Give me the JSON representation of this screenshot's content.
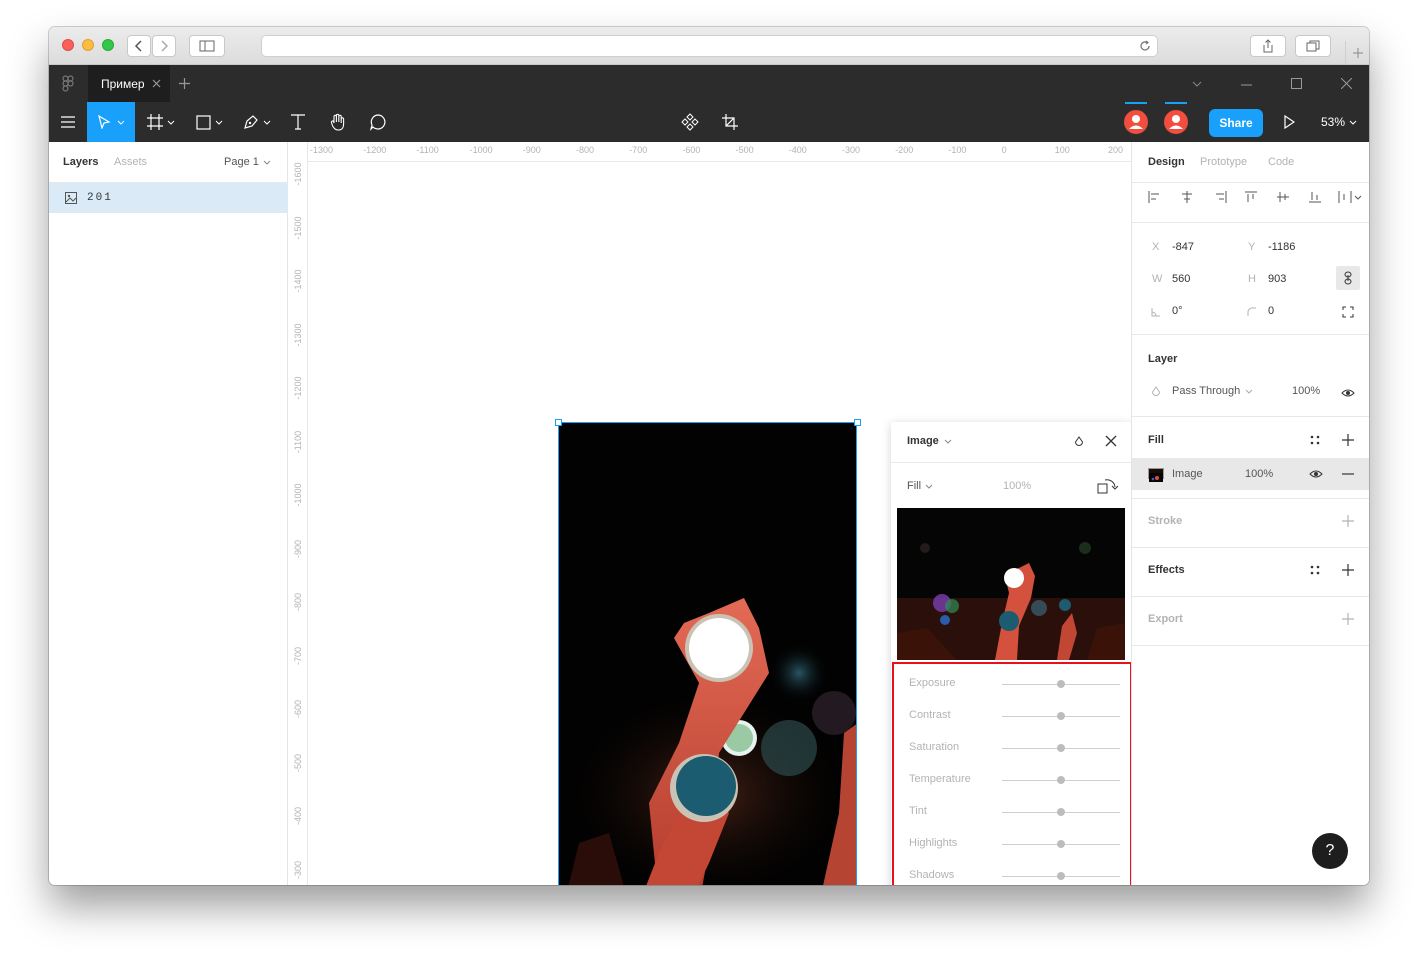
{
  "browser": {
    "traffic_lights": [
      "#fc605b",
      "#fdbc40",
      "#34c84a"
    ]
  },
  "figma": {
    "tab": {
      "title": "Пример"
    },
    "toolbar": {
      "share_label": "Share",
      "zoom": "53%"
    },
    "left_panel": {
      "tabs": [
        "Layers",
        "Assets"
      ],
      "page": "Page 1",
      "layers": [
        {
          "name": "201"
        }
      ]
    },
    "rulers": {
      "horizontal": [
        "-1300",
        "-1200",
        "-1100",
        "-1000",
        "-900",
        "-800",
        "-700",
        "-600",
        "-500",
        "-400",
        "-300",
        "-200",
        "-100",
        "0",
        "100",
        "200"
      ],
      "vertical": [
        "-1600",
        "-1500",
        "-1400",
        "-1300",
        "-1200",
        "-1100",
        "-1000",
        "-900",
        "-800",
        "-700",
        "-600",
        "-500",
        "-400",
        "-300"
      ]
    },
    "right_panel": {
      "tabs": [
        "Design",
        "Prototype",
        "Code"
      ],
      "x_label": "X",
      "x": "-847",
      "y_label": "Y",
      "y": "-1186",
      "w_label": "W",
      "w": "560",
      "h_label": "H",
      "h": "903",
      "rotation": "0°",
      "radius": "0",
      "layer": {
        "title": "Layer",
        "blend": "Pass Through",
        "opacity": "100%"
      },
      "fill": {
        "title": "Fill",
        "type": "Image",
        "opacity": "100%"
      },
      "stroke": {
        "title": "Stroke"
      },
      "effects": {
        "title": "Effects"
      },
      "export": {
        "title": "Export"
      }
    },
    "image_popup": {
      "title": "Image",
      "mode": "Fill",
      "opacity": "100%",
      "adjustments": [
        {
          "label": "Exposure",
          "value": 0
        },
        {
          "label": "Contrast",
          "value": 0
        },
        {
          "label": "Saturation",
          "value": 0
        },
        {
          "label": "Temperature",
          "value": 0
        },
        {
          "label": "Tint",
          "value": 0
        },
        {
          "label": "Highlights",
          "value": 0
        },
        {
          "label": "Shadows",
          "value": 0
        }
      ]
    },
    "help_label": "?"
  },
  "colors": {
    "accent": "#18a0fb",
    "highlight_box": "#e8101a",
    "dark_bar": "#2c2c2c",
    "avatar": "#f24e3f"
  }
}
